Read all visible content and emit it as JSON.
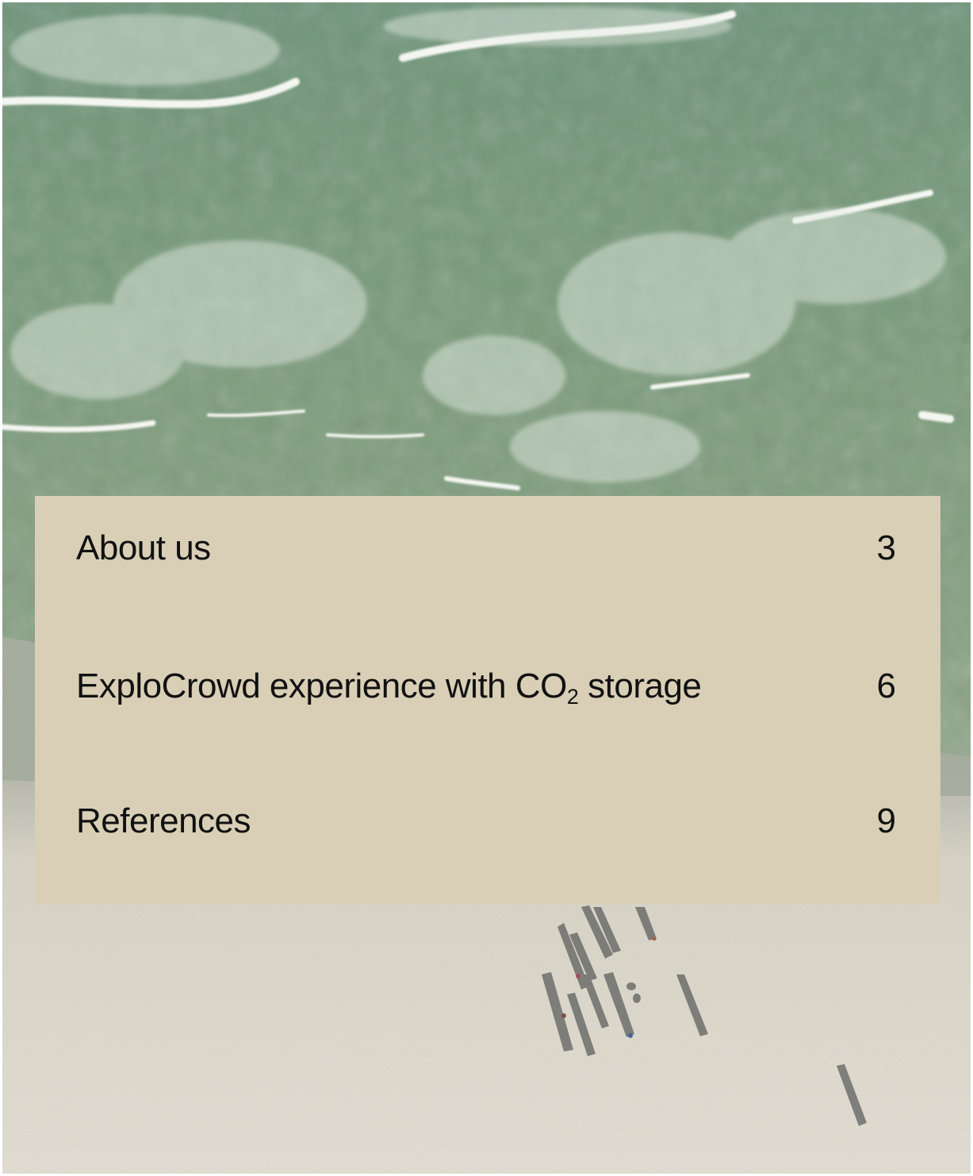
{
  "toc": {
    "items": [
      {
        "title": "About us",
        "page": "3"
      },
      {
        "title_pre": "ExploCrowd experience with CO",
        "title_sub": "2",
        "title_post": " storage",
        "page": "6"
      },
      {
        "title": "References",
        "page": "9"
      }
    ]
  },
  "colors": {
    "panel": "#d8cfb6",
    "sea": "#7a9a7c",
    "sand": "#ddd8cb",
    "text": "#111111"
  }
}
